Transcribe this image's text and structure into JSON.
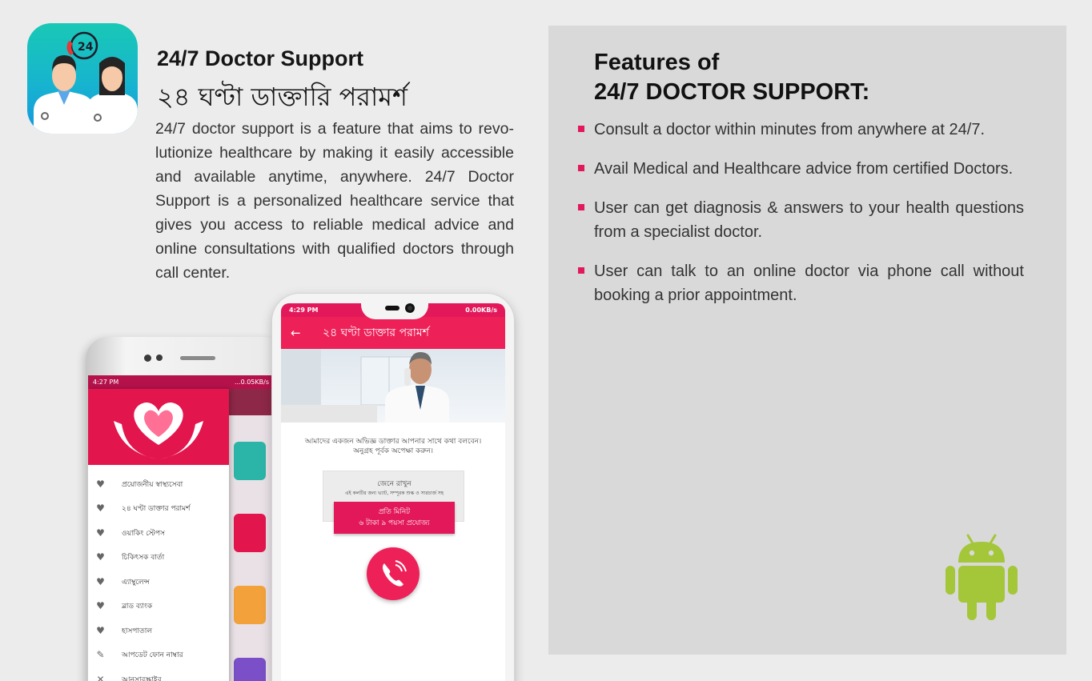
{
  "app": {
    "title_en": "24/7 Doctor Support",
    "title_bn": "২৪ ঘণ্টা ডাক্তারি পরামর্শ",
    "description": "24/7 doctor support is a feature that aims to revo-lutionize healthcare by making it easily accessible and available anytime, anywhere. 24/7 Doctor Support is a personalized healthcare service that gives you access to reliable medical advice and online consultations with qualified doctors through call center.",
    "icon_badge": "24"
  },
  "features": {
    "title_line1": "Features of",
    "title_line2": "24/7 DOCTOR SUPPORT:",
    "items": [
      "Consult a doctor within minutes from anywhere at 24/7.",
      "Avail Medical and Healthcare advice from certified Doctors.",
      "User can get diagnosis & answers to your health questions from a specialist doctor.",
      "User can talk to an online doctor via phone call without booking a prior appointment."
    ]
  },
  "phone_back": {
    "status_time": "4:27 PM",
    "status_right": "...0.05KB/s",
    "menu": [
      "প্রয়োজনীয় স্বাস্থ্যসেবা",
      "২৪ ঘণ্টা ডাক্তার পরামর্শ",
      "ওয়াকিং স্টেপস",
      "চিকিৎসক বার্তা",
      "এ্যাম্বুলেন্স",
      "ব্লাড ব্যাংক",
      "হাসপাতাল",
      "আপডেট ফোন নাম্বার",
      "আনসাবস্ক্রাইব"
    ]
  },
  "phone_front": {
    "status_time": "4:29 PM",
    "status_right": "0.00KB/s",
    "appbar_title": "২৪ ঘণ্টা ডাক্তার পরামর্শ",
    "message_line1": "আমাদের একজন অভিজ্ঞ ডাক্তার আপনার সাথে কথা বলবেন।",
    "message_line2": "অনুগ্রহ পূর্বক অপেক্ষা করুন।",
    "note_title": "জেনে রাখুন",
    "note_text": "এই কলটির জন্য ভ্যাট, সম্পূরক শুল্ক ও সারচার্জ সহ",
    "rate_line1": "প্রতি মিনিট",
    "rate_line2": "৬ টাকা ৯ পয়সা প্রযোজ্য"
  },
  "colors": {
    "accent": "#e2185a",
    "app_icon_gradient": [
      "#19c8b5",
      "#1497e0"
    ],
    "android_green": "#a4c639"
  }
}
